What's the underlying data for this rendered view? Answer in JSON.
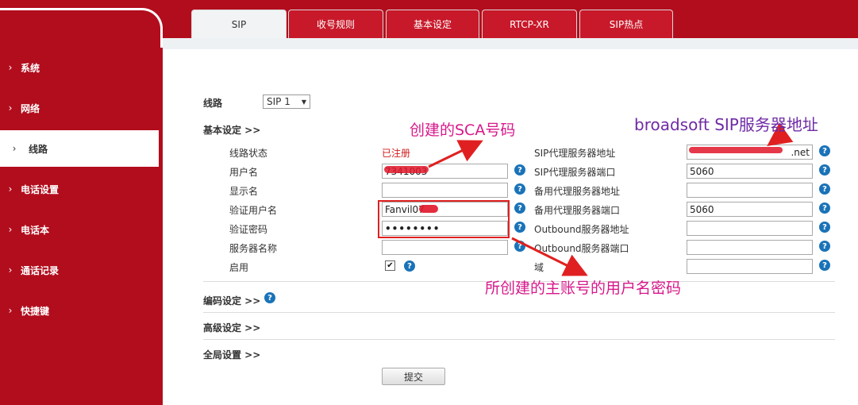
{
  "tabs": [
    {
      "label": "SIP",
      "active": true
    },
    {
      "label": "收号规则",
      "active": false
    },
    {
      "label": "基本设定",
      "active": false
    },
    {
      "label": "RTCP-XR",
      "active": false
    },
    {
      "label": "SIP热点",
      "active": false
    }
  ],
  "sidebar": {
    "items": [
      {
        "label": "系统",
        "active": false
      },
      {
        "label": "网络",
        "active": false
      },
      {
        "label": "线路",
        "active": true
      },
      {
        "label": "电话设置",
        "active": false
      },
      {
        "label": "电话本",
        "active": false
      },
      {
        "label": "通话记录",
        "active": false
      },
      {
        "label": "快捷键",
        "active": false
      }
    ],
    "chevron": "›"
  },
  "line": {
    "label": "线路",
    "selected": "SIP 1",
    "arrow": "▼"
  },
  "basic": {
    "title": "基本设定 >>"
  },
  "left_fields": {
    "status_label": "线路状态",
    "status_value": "已注册",
    "username_label": "用户名",
    "username_value": "7341003",
    "display_label": "显示名",
    "display_value": "",
    "auth_user_label": "验证用户名",
    "auth_user_value": "Fanvil07",
    "auth_pass_label": "验证密码",
    "auth_pass_value": "••••••••",
    "server_name_label": "服务器名称",
    "server_name_value": "",
    "enable_label": "启用",
    "enable_checked": "✔"
  },
  "right_fields": {
    "proxy_addr_label": "SIP代理服务器地址",
    "proxy_addr_value": ".net",
    "proxy_port_label": "SIP代理服务器端口",
    "proxy_port_value": "5060",
    "backup_addr_label": "备用代理服务器地址",
    "backup_addr_value": "",
    "backup_port_label": "备用代理服务器端口",
    "backup_port_value": "5060",
    "outbound_addr_label": "Outbound服务器地址",
    "outbound_addr_value": "",
    "outbound_port_label": "Outbound服务器端口",
    "outbound_port_value": "",
    "domain_label": "域",
    "domain_value": ""
  },
  "sections": {
    "codec": "编码设定 >>",
    "advanced": "高级设定 >>",
    "global": "全局设置 >>"
  },
  "submit_label": "提交",
  "help_glyph": "?",
  "annotations": {
    "sca": "创建的SCA号码",
    "server": "broadsoft SIP服务器地址",
    "account": "所创建的主账号的用户名密码"
  },
  "colors": {
    "brand_red": "#b20d1d",
    "help_blue": "#1a73b8",
    "registered_red": "#d11b1b",
    "annotation_pink": "#d8188a",
    "annotation_purple": "#6f2aa6"
  }
}
